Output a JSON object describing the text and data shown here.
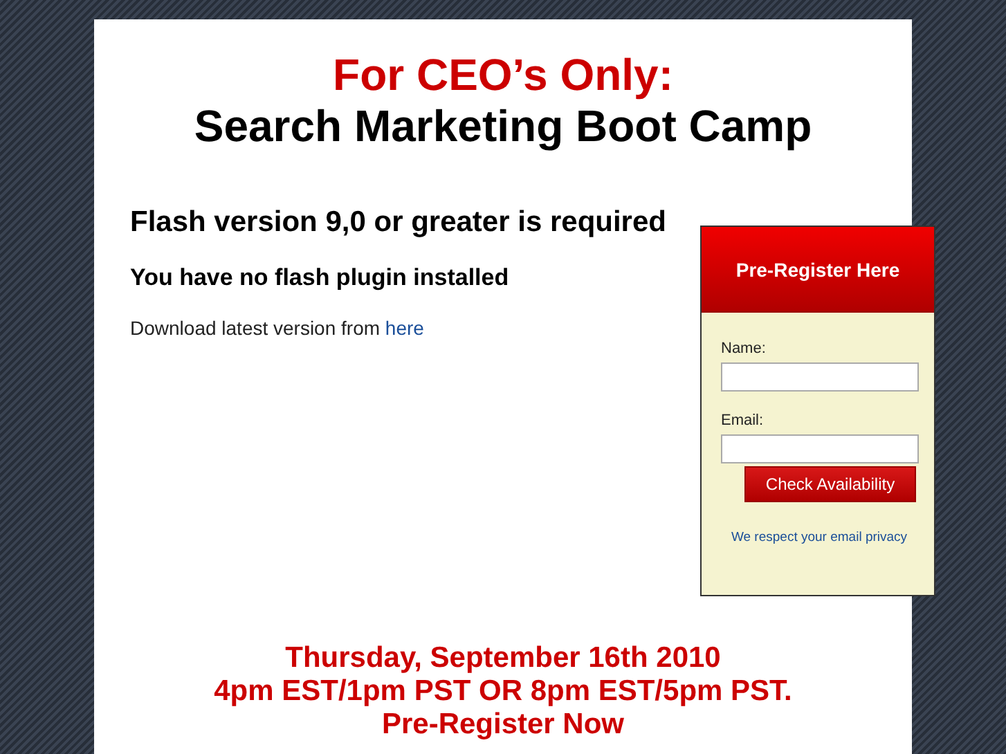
{
  "header": {
    "title_red": "For CEO’s Only:",
    "title": "Search Marketing Boot Camp"
  },
  "notice": {
    "heading": "Flash version 9,0 or greater is required",
    "subheading": "You have no flash plugin installed",
    "download_text": "Download latest version from",
    "download_link": "here"
  },
  "form": {
    "title": "Pre-Register Here",
    "fields": [
      {
        "label": "Name:"
      },
      {
        "label": "Email:"
      }
    ],
    "button": "Check Availability",
    "privacy_link": "We respect your email privacy"
  },
  "event": {
    "lines": [
      "Thursday, September 16th 2010",
      "4pm EST/1pm PST OR 8pm EST/5pm PST.",
      "Pre-Register Now"
    ]
  }
}
